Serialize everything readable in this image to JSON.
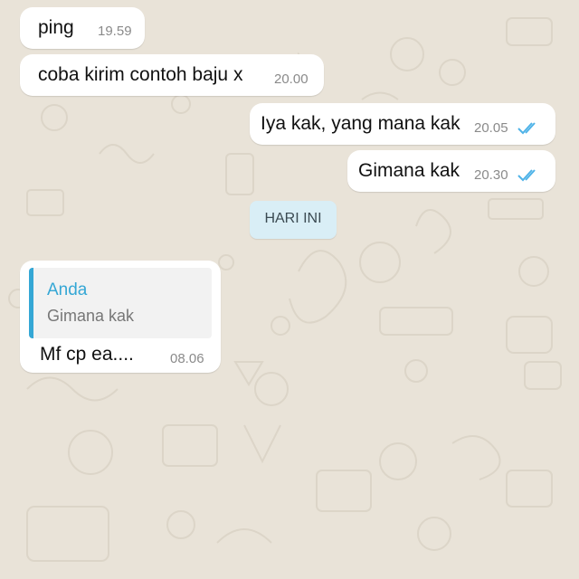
{
  "colors": {
    "wallpaper": "#e9e3d8",
    "bubble": "#ffffff",
    "read_ticks": "#4fb3e8",
    "date_chip": "#d9eef6",
    "quote_accent": "#35a7d5"
  },
  "messages": [
    {
      "direction": "incoming",
      "text": "ping",
      "time": "19.59"
    },
    {
      "direction": "incoming",
      "text": "coba kirim contoh baju x",
      "time": "20.00"
    },
    {
      "direction": "outgoing",
      "text": "Iya kak, yang mana kak",
      "time": "20.05",
      "status_icon": "double-check-read-icon"
    },
    {
      "direction": "outgoing",
      "text": "Gimana kak",
      "time": "20.30",
      "status_icon": "double-check-read-icon"
    }
  ],
  "date_separator": "HARI INI",
  "reply_message": {
    "direction": "incoming",
    "quoted": {
      "author": "Anda",
      "text": "Gimana kak"
    },
    "text": "Mf cp ea....",
    "time": "08.06"
  }
}
